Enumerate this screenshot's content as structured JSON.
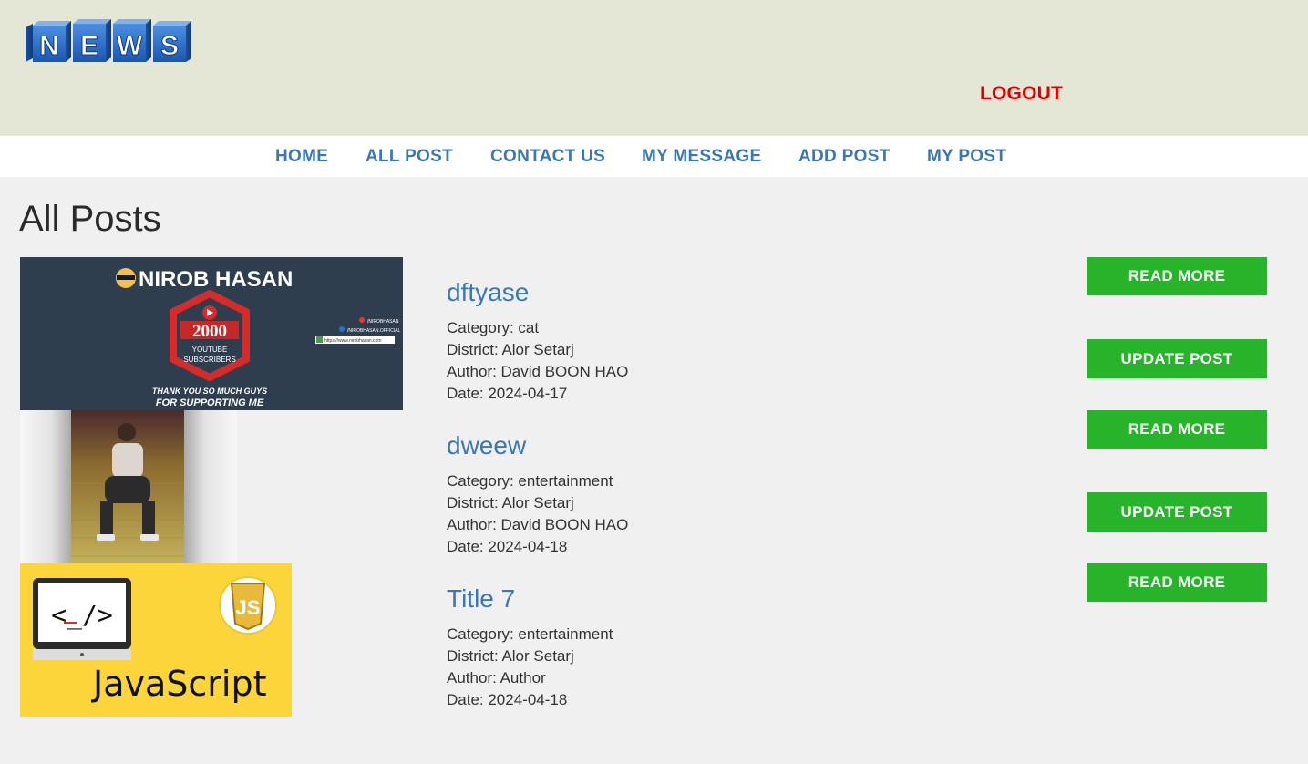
{
  "header": {
    "logo_letters": [
      "N",
      "E",
      "W",
      "S"
    ],
    "logout_label": "LOGOUT",
    "logout_color": "#e00000",
    "background": "#e4e6d6"
  },
  "nav": {
    "items": [
      {
        "label": "HOME"
      },
      {
        "label": "ALL POST"
      },
      {
        "label": "CONTACT US"
      },
      {
        "label": "MY MESSAGE"
      },
      {
        "label": "ADD POST"
      },
      {
        "label": "MY POST"
      }
    ],
    "color": "#3a78b5"
  },
  "page": {
    "title": "All Posts"
  },
  "thumbnails": [
    {
      "name": "NIROB HASAN",
      "count": "2000",
      "badge_line1": "YOUTUBE",
      "badge_line2": "SUBSCRIBERS",
      "footer_line1": "THANK YOU SO MUCH GUYS",
      "footer_line2": "FOR SUPPORTING ME",
      "social_1": "/NIROBHASAN",
      "social_2": "/NIROBHASAN.OFFICIAL",
      "social_3": "https://www.nirobhasan.com"
    },
    {
      "alt": "person sitting on stairs photo"
    },
    {
      "code_glyph": "<_/>",
      "js_badge": "JS",
      "label": "JavaScript"
    }
  ],
  "posts": [
    {
      "title": "dftyase",
      "category": "Category: cat",
      "district": "District: Alor Setarj",
      "author": "Author: David BOON HAO",
      "date": "Date: 2024-04-17"
    },
    {
      "title": "dweew",
      "category": "Category: entertainment",
      "district": "District: Alor Setarj",
      "author": "Author: David BOON HAO",
      "date": "Date: 2024-04-18"
    },
    {
      "title": "Title 7",
      "category": "Category: entertainment",
      "district": "District: Alor Setarj",
      "author": "Author: Author",
      "date": "Date: 2024-04-18"
    }
  ],
  "buttons": {
    "read_more": "READ MORE",
    "update_post": "UPDATE POST",
    "color": "#27b42b"
  }
}
